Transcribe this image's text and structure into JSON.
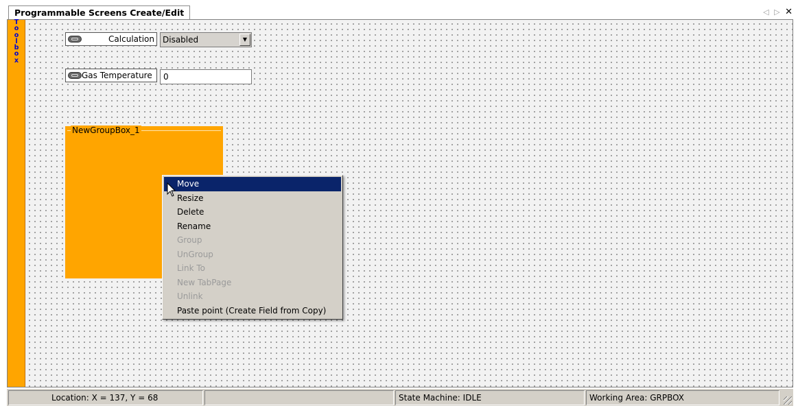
{
  "tab": {
    "title": "Programmable Screens Create/Edit",
    "nav_left": "◁",
    "nav_right": "▷",
    "close": "✕"
  },
  "toolbox": {
    "label": "T\no\no\nl\nb\no\nx"
  },
  "fields": {
    "calculation": {
      "label": "Calculation",
      "value": "Disabled",
      "icon": "chain-link-icon"
    },
    "gas_temperature": {
      "label": "Gas Temperature",
      "value": "0",
      "icon": "chain-link-icon"
    }
  },
  "groupbox": {
    "title": "NewGroupBox_1",
    "color": "#ffa500"
  },
  "context_menu": {
    "items": [
      {
        "label": "Move",
        "enabled": true,
        "selected": true
      },
      {
        "label": "Resize",
        "enabled": true
      },
      {
        "label": "Delete",
        "enabled": true
      },
      {
        "label": "Rename",
        "enabled": true
      },
      {
        "label": "Group",
        "enabled": false
      },
      {
        "label": "UnGroup",
        "enabled": false
      },
      {
        "label": "Link To",
        "enabled": false
      },
      {
        "label": "New TabPage",
        "enabled": false
      },
      {
        "label": "Unlink",
        "enabled": false
      },
      {
        "label": "Paste point (Create Field from Copy)",
        "enabled": true
      }
    ]
  },
  "statusbar": {
    "location": "Location: X = 137, Y = 68",
    "blank": "",
    "state": "State Machine: IDLE",
    "area": "Working Area: GRPBOX"
  },
  "colors": {
    "toolbox": "#ffa500",
    "menu_highlight": "#0a246a"
  }
}
